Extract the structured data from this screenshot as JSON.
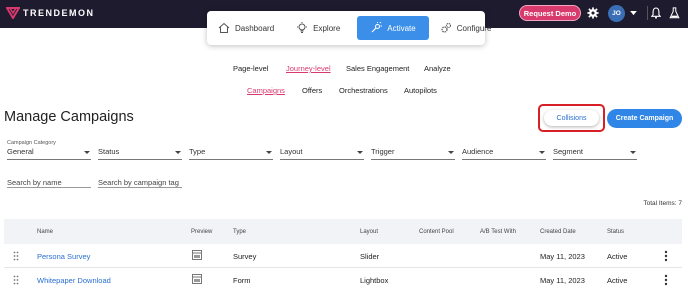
{
  "brand": {
    "name": "TRENDEMON",
    "accent": "#d83a6e"
  },
  "topbar": {
    "request_demo": "Request Demo",
    "avatar_initials": "JO"
  },
  "main_nav": [
    {
      "label": "Dashboard",
      "icon": "home-icon",
      "active": false
    },
    {
      "label": "Explore",
      "icon": "lightbulb-icon",
      "active": false
    },
    {
      "label": "Activate",
      "icon": "activate-icon",
      "active": true
    },
    {
      "label": "Configure",
      "icon": "gears-icon",
      "active": false
    }
  ],
  "subnav_primary": [
    "Page-level",
    "Journey-level",
    "Sales Engagement",
    "Analyze"
  ],
  "subnav_primary_active": "Journey-level",
  "subnav_secondary": [
    "Campaigns",
    "Offers",
    "Orchestrations",
    "Autopilots"
  ],
  "subnav_secondary_active": "Campaigns",
  "page_title": "Manage Campaigns",
  "actions": {
    "collisions": "Collisions",
    "create": "Create Campaign"
  },
  "filters": [
    {
      "label": "Campaign Category",
      "value": "General"
    },
    {
      "label": "",
      "value": "Status"
    },
    {
      "label": "",
      "value": "Type"
    },
    {
      "label": "",
      "value": "Layout"
    },
    {
      "label": "",
      "value": "Trigger"
    },
    {
      "label": "",
      "value": "Audience"
    },
    {
      "label": "",
      "value": "Segment"
    }
  ],
  "search": {
    "name_placeholder": "Search by name",
    "tag_placeholder": "Search by campaign tag"
  },
  "total_items": "Total Items: 7",
  "table": {
    "columns": [
      "Name",
      "Preview",
      "Type",
      "Layout",
      "Content Pool",
      "A/B Test With",
      "Created Date",
      "Status"
    ],
    "rows": [
      {
        "name": "Persona Survey",
        "type": "Survey",
        "layout": "Slider",
        "content_pool": "",
        "ab_test": "",
        "created": "May 11, 2023",
        "status": "Active"
      },
      {
        "name": "Whitepaper Download",
        "type": "Form",
        "layout": "Lightbox",
        "content_pool": "",
        "ab_test": "",
        "created": "May 11, 2023",
        "status": "Active"
      }
    ]
  }
}
